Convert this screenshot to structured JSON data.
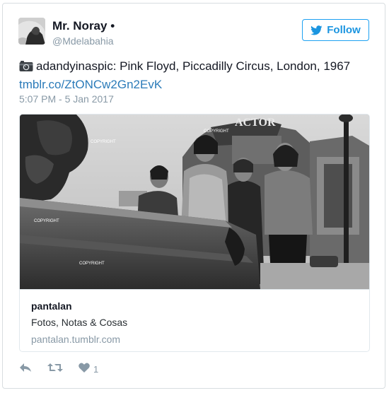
{
  "author": {
    "display_name": "Mr. Noray •",
    "handle": "@Mdelabahia",
    "avatar": "profile-photo"
  },
  "follow_button": {
    "label": "Follow",
    "icon": "twitter-bird-icon"
  },
  "tweet": {
    "icon": "camera-icon",
    "text": "adandyinaspic: Pink Floyd, Piccadilly Circus, London, 1967",
    "link": "tmblr.co/ZtONCw2Gn2EvK",
    "timestamp": "5:07 PM - 5 Jan 2017"
  },
  "media": {
    "photo": "black-and-white photo of Pink Floyd band members at Piccadilly Circus",
    "watermarks": [
      "COPYRIGHT",
      "COPYRIGHT",
      "COPYRIGHT",
      "COPYRIGHT"
    ],
    "sign_text": "ACTOR"
  },
  "card": {
    "title": "pantalan",
    "description": "Fotos, Notas & Cosas",
    "domain": "pantalan.tumblr.com"
  },
  "actions": {
    "reply_icon": "reply-icon",
    "retweet_icon": "retweet-icon",
    "like_icon": "heart-icon",
    "like_count": "1"
  },
  "colors": {
    "accent": "#1da1f2",
    "link": "#2b7bb9",
    "muted": "#8899a6",
    "text": "#141823"
  }
}
